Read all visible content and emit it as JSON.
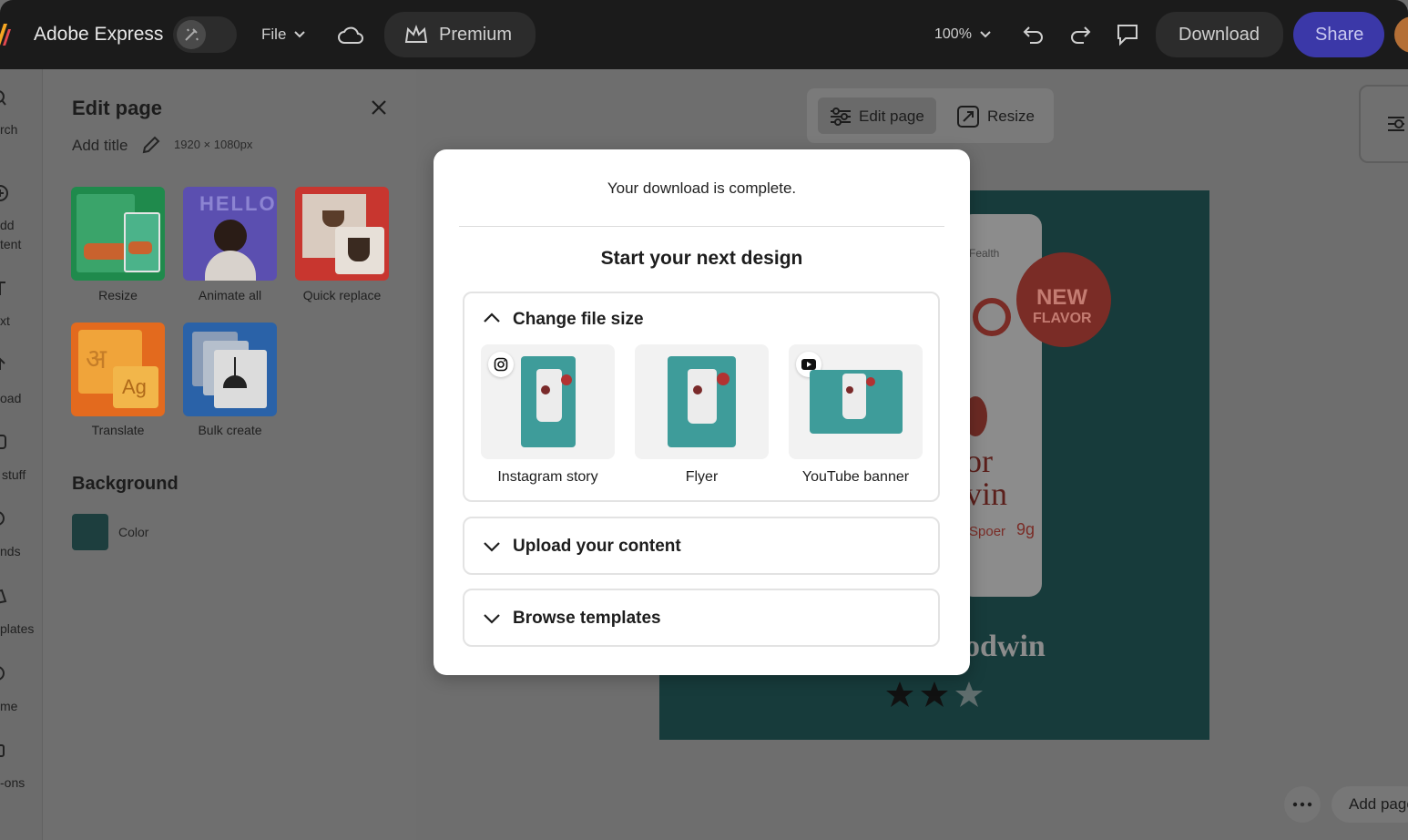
{
  "app": {
    "name": "Adobe Express"
  },
  "topbar": {
    "file_label": "File",
    "premium_label": "Premium",
    "zoom": "100%",
    "download_label": "Download",
    "share_label": "Share"
  },
  "leftrail": {
    "items": [
      "rch",
      "dd",
      "tent",
      "xt",
      "oad",
      "stuff",
      "nds",
      "plates",
      "me",
      "-ons"
    ]
  },
  "panel": {
    "title": "Edit page",
    "add_title": "Add title",
    "dimensions": "1920 × 1080px",
    "tools": [
      {
        "label": "Resize"
      },
      {
        "label": "Animate all"
      },
      {
        "label": "Quick replace"
      },
      {
        "label": "Translate"
      },
      {
        "label": "Bulk create"
      }
    ],
    "background_title": "Background",
    "color_label": "Color",
    "tile_text": {
      "hello": "HELLO",
      "translate_a": "अ",
      "translate_b": "Ag"
    }
  },
  "canvas": {
    "edit_page_label": "Edit page",
    "resize_label": "Resize",
    "design_text": {
      "health": "Fealth",
      "badge_line1": "NEW",
      "badge_line2": "FLAVOR",
      "word1": "or",
      "word2": "vin",
      "spoer": "Spoer",
      "grams": "9g",
      "brand": "odwin"
    },
    "add_page_label": "Add page"
  },
  "modal": {
    "message": "Your download is complete.",
    "title": "Start your next design",
    "sections": [
      {
        "title": "Change file size",
        "expanded": true,
        "options": [
          {
            "label": "Instagram story",
            "badge": "instagram-icon"
          },
          {
            "label": "Flyer"
          },
          {
            "label": "YouTube banner",
            "badge": "youtube-icon"
          }
        ]
      },
      {
        "title": "Upload your content",
        "expanded": false
      },
      {
        "title": "Browse templates",
        "expanded": false
      }
    ]
  },
  "colors": {
    "share": "#3b38a8",
    "design_bg": "#173b3b",
    "thumb_teal": "#3e9c9a"
  }
}
